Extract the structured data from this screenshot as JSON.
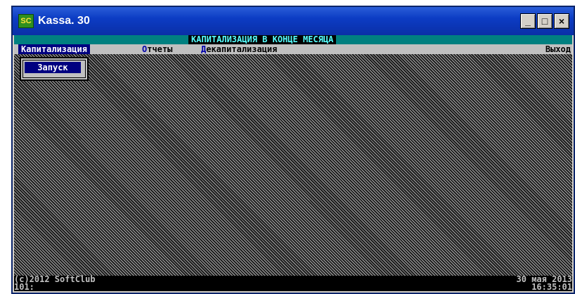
{
  "window": {
    "title": "Kassa. 30",
    "icon_text": "SC"
  },
  "controls": {
    "minimize": "_",
    "maximize": "□",
    "close": "×"
  },
  "header": {
    "title": "КАПИТАЛИЗАЦИЯ В КОНЦЕ МЕСЯЦА"
  },
  "menu": {
    "items": [
      {
        "label": "Капитализация",
        "active": true
      },
      {
        "hotkey": "О",
        "rest": "тчеты"
      },
      {
        "hotkey": "Д",
        "rest": "екапитализация"
      }
    ],
    "exit": "Выход"
  },
  "popup": {
    "run_label": "Запуск"
  },
  "status": {
    "copyright": "(c)2012 SoftClub",
    "date": "30 мая 2013",
    "prompt": "101:",
    "time": "16:35:01"
  },
  "colors": {
    "desktop_pattern": "#a8a8a8",
    "menu_active": "#000080",
    "header_bg": "#008080",
    "header_text": "#55ffff"
  }
}
